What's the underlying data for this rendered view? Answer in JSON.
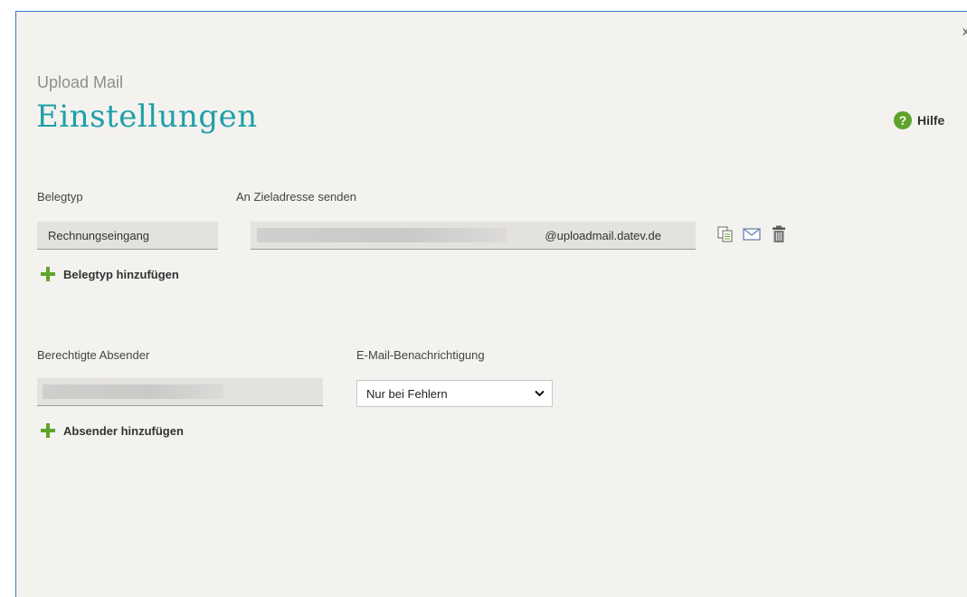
{
  "dialog": {
    "close_label": "x",
    "subtitle": "Upload Mail",
    "title": "Einstellungen",
    "help_label": "Hilfe",
    "help_icon": "question-circle-icon"
  },
  "doc_types": {
    "label": "Belegtyp",
    "target_label": "An Zieladresse senden",
    "rows": [
      {
        "type": "Rechnungseingang",
        "address_suffix": "@uploadmail.datev.de"
      }
    ],
    "add_label": "Belegtyp hinzufügen",
    "icons": [
      "copy-icon",
      "envelope-icon",
      "trash-icon"
    ]
  },
  "senders": {
    "label": "Berechtigte Absender",
    "add_label": "Absender hinzufügen"
  },
  "notification": {
    "label": "E-Mail-Benachrichtigung",
    "selected": "Nur bei Fehlern"
  },
  "colors": {
    "accent": "#1f9fa8",
    "green": "#5fa32b",
    "background": "#f3f2ef"
  }
}
